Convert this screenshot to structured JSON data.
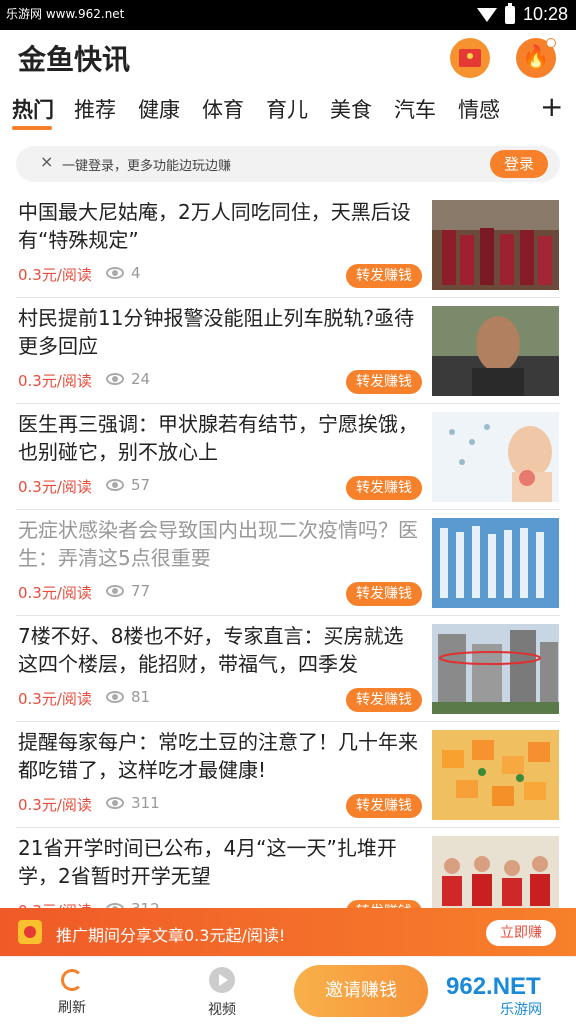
{
  "status_bar": {
    "site": "乐游网 www.962.net",
    "time": "10:28"
  },
  "header": {
    "title": "金鱼快讯"
  },
  "tabs": [
    {
      "label": "热门",
      "active": true
    },
    {
      "label": "推荐"
    },
    {
      "label": "健康"
    },
    {
      "label": "体育"
    },
    {
      "label": "育儿"
    },
    {
      "label": "美食"
    },
    {
      "label": "汽车"
    },
    {
      "label": "情感"
    }
  ],
  "tabs_more": "+",
  "login_bar": {
    "close": "×",
    "text": "一键登录，更多功能边玩边赚",
    "button": "登录"
  },
  "share_label": "转发赚钱",
  "articles": [
    {
      "title": "中国最大尼姑庵，2万人同吃同住，天黑后设有“特殊规定”",
      "price": "0.3元/阅读",
      "views": "4",
      "read": false
    },
    {
      "title": "村民提前11分钟报警没能阻止列车脱轨?亟待更多回应",
      "price": "0.3元/阅读",
      "views": "24",
      "read": false
    },
    {
      "title": "医生再三强调：甲状腺若有结节，宁愿挨饿，也别碰它，别不放心上",
      "price": "0.3元/阅读",
      "views": "57",
      "read": false
    },
    {
      "title": "无症状感染者会导致国内出现二次疫情吗？医生：弄清这5点很重要",
      "price": "0.3元/阅读",
      "views": "77",
      "read": true
    },
    {
      "title": "7楼不好、8楼也不好，专家直言：买房就选这四个楼层，能招财，带福气，四季发",
      "price": "0.3元/阅读",
      "views": "81",
      "read": false
    },
    {
      "title": "提醒每家每户：常吃土豆的注意了！几十年来都吃错了，这样吃才最健康!",
      "price": "0.3元/阅读",
      "views": "311",
      "read": false
    },
    {
      "title": "21省开学时间已公布，4月“这一天”扎堆开学，2省暂时开学无望",
      "price": "0.3元/阅读",
      "views": "312",
      "read": false
    }
  ],
  "promo": {
    "text": "推广期间分享文章0.3元起/阅读!",
    "button": "立即赚"
  },
  "bottom_nav": {
    "refresh": "刷新",
    "video": "视频",
    "invite": "邀请赚钱"
  },
  "watermark": {
    "text": "962.NET",
    "subtext": "乐游网"
  },
  "colors": {
    "accent": "#f7802b",
    "price_red": "#e84d3c"
  }
}
